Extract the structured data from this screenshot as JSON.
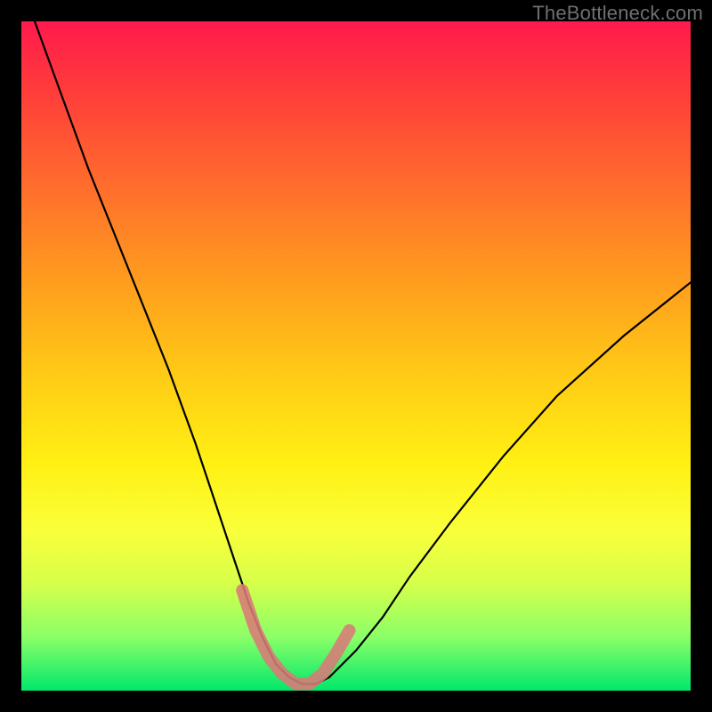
{
  "watermark": "TheBottleneck.com",
  "chart_data": {
    "type": "line",
    "title": "",
    "xlabel": "",
    "ylabel": "",
    "xlim": [
      0,
      100
    ],
    "ylim": [
      0,
      100
    ],
    "grid": false,
    "legend": false,
    "series": [
      {
        "name": "bottleneck-curve",
        "color": "#000000",
        "x": [
          2,
          6,
          10,
          14,
          18,
          22,
          26,
          28,
          30,
          32,
          34,
          36,
          38,
          40,
          42,
          44,
          46,
          50,
          54,
          58,
          64,
          72,
          80,
          90,
          100
        ],
        "y": [
          100,
          89,
          78,
          68,
          58,
          48,
          37,
          31,
          25,
          19,
          13,
          8,
          4,
          2,
          1,
          1,
          2,
          6,
          11,
          17,
          25,
          35,
          44,
          53,
          61
        ]
      }
    ],
    "highlight": {
      "name": "optimal-range",
      "color": "#d97a78",
      "x": [
        33,
        35,
        37,
        39,
        41,
        43,
        45,
        47,
        49
      ],
      "y": [
        15,
        9,
        5,
        2.5,
        1,
        1,
        2.5,
        5.5,
        9
      ]
    }
  },
  "colors": {
    "gradient_top": "#ff1a4d",
    "gradient_bottom": "#00e86b",
    "highlight": "#d97a78",
    "curve": "#000000",
    "frame": "#000000"
  }
}
